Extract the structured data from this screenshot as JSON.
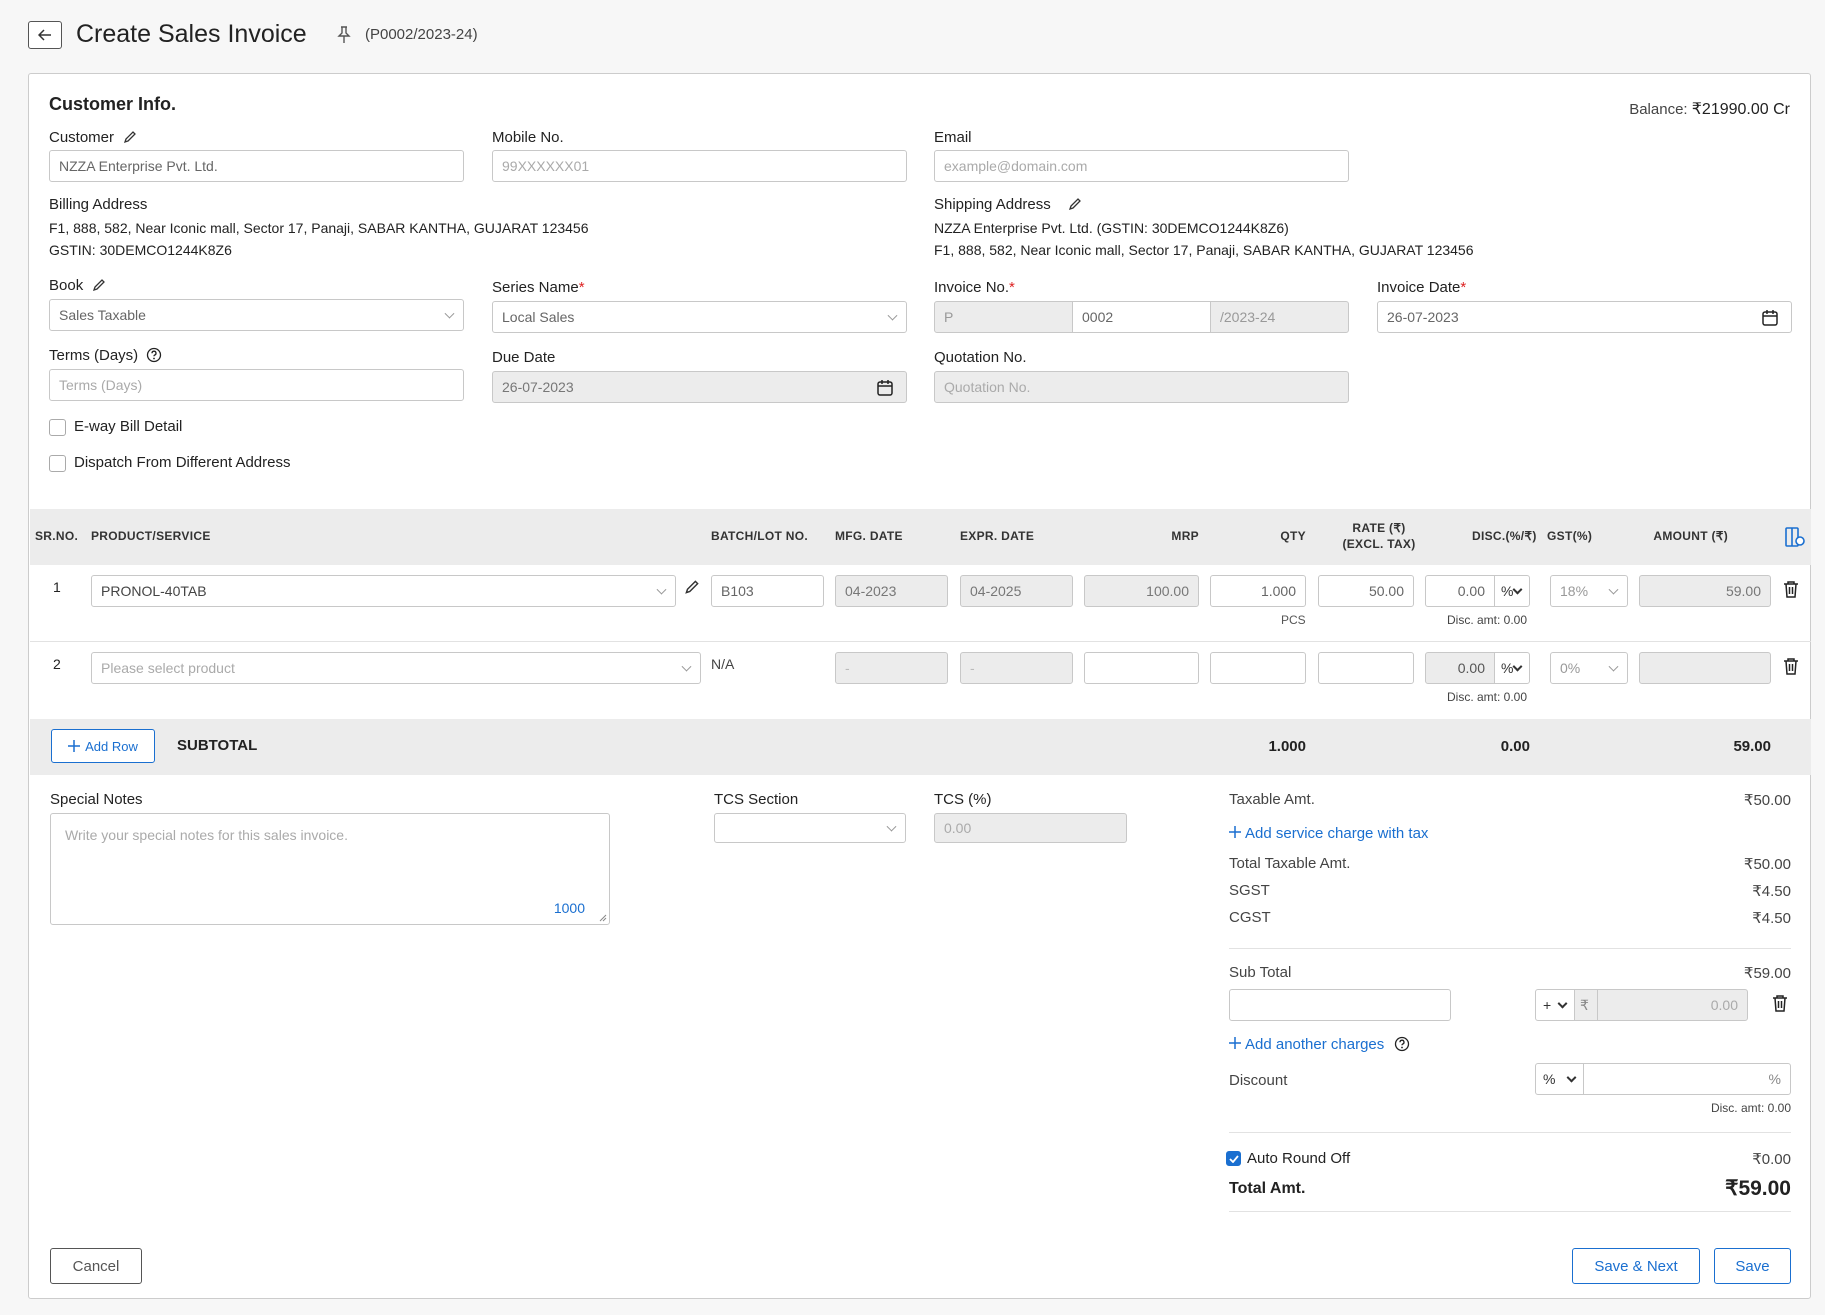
{
  "header": {
    "title": "Create Sales Invoice",
    "code": "(P0002/2023-24)"
  },
  "customer_info": {
    "section_title": "Customer Info.",
    "balance_label": "Balance:",
    "balance_value": "₹21990.00 Cr",
    "customer_label": "Customer",
    "customer_value": "NZZA Enterprise Pvt. Ltd.",
    "mobile_label": "Mobile No.",
    "mobile_value": "99XXXXXX01",
    "email_label": "Email",
    "email_placeholder": "example@domain.com",
    "billing_label": "Billing Address",
    "billing_address": "F1, 888, 582, Near Iconic mall, Sector 17, Panaji, SABAR KANTHA, GUJARAT 123456",
    "billing_gstin_label": "GSTIN:",
    "billing_gstin": "30DEMCO1244K8Z6",
    "shipping_label": "Shipping Address",
    "shipping_name": "NZZA Enterprise Pvt. Ltd. (",
    "shipping_gstin_label": "GSTIN:",
    "shipping_gstin": "30DEMCO1244K8Z6)",
    "shipping_address": "F1, 888, 582, Near Iconic mall, Sector 17, Panaji, SABAR KANTHA, GUJARAT 123456",
    "book_label": "Book",
    "book_value": "Sales Taxable",
    "series_label": "Series Name",
    "series_value": "Local Sales",
    "invoice_no_label": "Invoice No.",
    "invoice_prefix": "P",
    "invoice_number": "0002",
    "invoice_suffix": "/2023-24",
    "invoice_date_label": "Invoice Date",
    "invoice_date": "26-07-2023",
    "terms_label": "Terms (Days)",
    "terms_placeholder": "Terms (Days)",
    "due_date_label": "Due Date",
    "due_date": "26-07-2023",
    "quotation_label": "Quotation No.",
    "quotation_placeholder": "Quotation No.",
    "eway_label": "E-way Bill Detail",
    "dispatch_label": "Dispatch From Different Address",
    "required_mark": "*"
  },
  "table": {
    "headers": {
      "sr": "SR.NO.",
      "product": "PRODUCT/SERVICE",
      "batch": "BATCH/LOT NO.",
      "mfg": "MFG. DATE",
      "expr": "EXPR. DATE",
      "mrp": "MRP",
      "qty": "QTY",
      "rate": "RATE (₹)",
      "rate2": "(EXCL. TAX)",
      "disc": "DISC.(%/₹)",
      "gst": "GST(%)",
      "amount": "AMOUNT (₹)"
    },
    "rows": [
      {
        "sr": "1",
        "product": "PRONOL-40TAB",
        "batch": "B103",
        "mfg": "04-2023",
        "expr": "04-2025",
        "mrp": "100.00",
        "qty": "1.000",
        "unit": "PCS",
        "rate": "50.00",
        "disc": "0.00",
        "disc_type": "%",
        "gst": "18%",
        "amount": "59.00",
        "disc_amt": "Disc. amt: 0.00"
      },
      {
        "sr": "2",
        "product_placeholder": "Please select product",
        "batch": "N/A",
        "mfg": "-",
        "expr": "-",
        "disc": "0.00",
        "disc_type": "%",
        "gst": "0%",
        "disc_amt": "Disc. amt: 0.00"
      }
    ],
    "add_row": "Add Row",
    "subtotal_label": "SUBTOTAL",
    "subtotal_qty": "1.000",
    "subtotal_disc": "0.00",
    "subtotal_amount": "59.00"
  },
  "notes": {
    "label": "Special Notes",
    "placeholder": "Write your special notes for this sales invoice.",
    "counter": "1000"
  },
  "tcs": {
    "section_label": "TCS Section",
    "pct_label": "TCS (%)",
    "pct_value": "0.00"
  },
  "summary": {
    "taxable_label": "Taxable Amt.",
    "taxable_value": "₹50.00",
    "add_service_charge": "Add service charge with tax",
    "total_taxable_label": "Total Taxable Amt.",
    "total_taxable_value": "₹50.00",
    "sgst_label": "SGST",
    "sgst_value": "₹4.50",
    "cgst_label": "CGST",
    "cgst_value": "₹4.50",
    "subtotal_label": "Sub Total",
    "subtotal_value": "₹59.00",
    "charge_sign": "+",
    "charge_currency": "₹",
    "charge_value": "0.00",
    "add_another_charges": "Add another charges",
    "discount_label": "Discount",
    "discount_type": "%",
    "discount_suffix": "%",
    "discount_amt": "Disc. amt: 0.00",
    "round_off_label": "Auto Round Off",
    "round_off_value": "₹0.00",
    "total_label": "Total Amt.",
    "total_value": "₹59.00"
  },
  "footer": {
    "cancel": "Cancel",
    "save_next": "Save & Next",
    "save": "Save"
  },
  "colors": {
    "accent": "#1a6fd0",
    "required": "#dd2222"
  }
}
